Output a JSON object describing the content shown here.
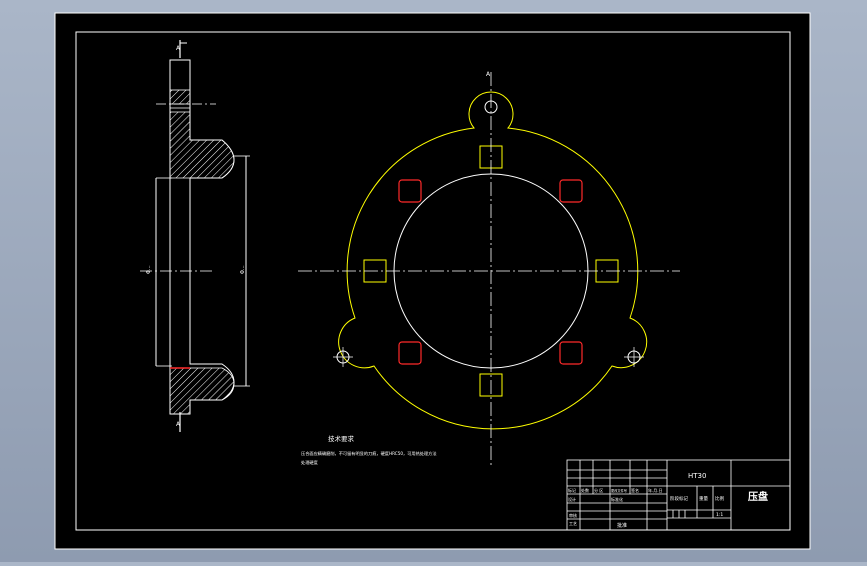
{
  "drawing": {
    "colors": {
      "background": "#000000",
      "frame": "#ffffff",
      "outline": "#ffff00",
      "slot_red": "#ff2a2a",
      "hatch": "#ffffff",
      "surround": "#9aa8bc"
    },
    "section_labels": {
      "top": "A",
      "bottom": "A"
    },
    "dimensions": {
      "inner": "Φ...",
      "outer": "Φ..."
    },
    "center_label": "A",
    "notes": {
      "heading": "技术要求",
      "lines": [
        "压合面应精确磨削，不可留有明显的刀痕，硬度HRC50，可用热处理方法",
        "处理硬度"
      ]
    },
    "title_block": {
      "material": "HT30",
      "part_name": "压盘",
      "scale_value": "1:1",
      "labels": {
        "mark": "标记",
        "count": "处数",
        "zone": "分 区",
        "change_doc": "更改文件号",
        "signature": "签名",
        "date": "年.月.日",
        "design": "设计",
        "standardization": "标准化",
        "stage_mark": "阶段标记",
        "weight": "重量",
        "scale": "比例",
        "review": "审核",
        "process": "工艺",
        "approve": "批准"
      }
    }
  }
}
